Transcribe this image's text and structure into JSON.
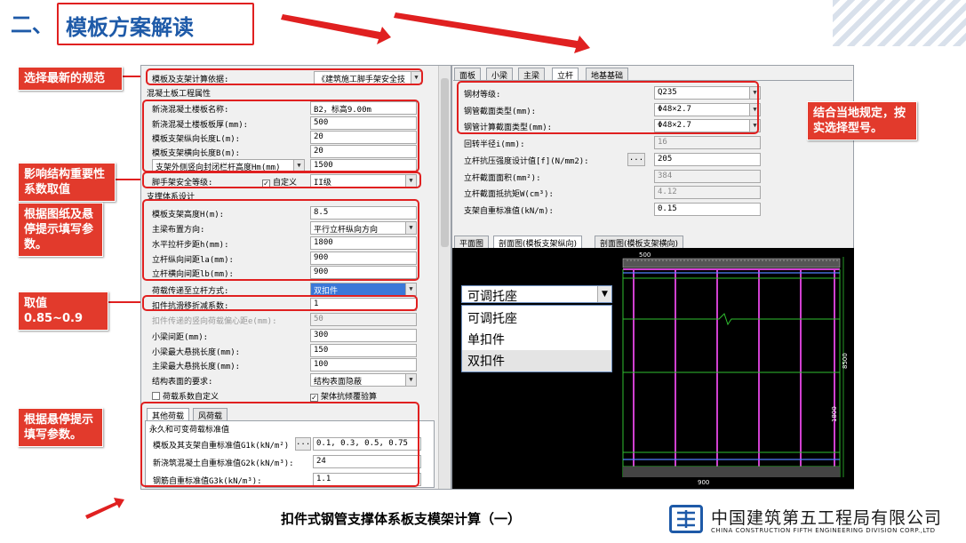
{
  "header": {
    "section_num": "二、",
    "title": "模板方案解读"
  },
  "annotations": {
    "a1": "选择最新的规范",
    "a2": "影响结构重要性系数取值",
    "a3": "根据图纸及悬停提示填写参数。",
    "a4": "取值0.85~0.9",
    "a5": "根据悬停提示填写参数。",
    "a6": "结合当地规定，按实选择型号。"
  },
  "left_panel": {
    "basis_label": "模板及支架计算依据:",
    "basis_value": "《建筑施工脚手架安全技",
    "sec1": "混凝土板工程属性",
    "r1_label": "新浇混凝土楼板名称:",
    "r1_value": "B2，标高9.00m",
    "r2_label": "新浇混凝土楼板板厚(mm):",
    "r2_value": "500",
    "r3_label": "模板支架纵向长度L(m):",
    "r3_value": "20",
    "r4_label": "模板支架横向长度B(m):",
    "r4_value": "20",
    "r5_label": "支架外侧竖向封闭栏杆高度Hm(mm)",
    "r5_value": "1500",
    "r6_label": "脚手架安全等级:",
    "r6_custom": "自定义",
    "r6_value": "II级",
    "sec2": "支撑体系设计",
    "r7_label": "模板支架高度H(m):",
    "r7_value": "8.5",
    "r8_label": "主梁布置方向:",
    "r8_value": "平行立杆纵向方向",
    "r9_label": "水平拉杆步距h(mm):",
    "r9_value": "1800",
    "r10_label": "立杆纵向间距la(mm):",
    "r10_value": "900",
    "r11_label": "立杆横向间距lb(mm):",
    "r11_value": "900",
    "r12_label": "荷载传递至立杆方式:",
    "r12_value": "双扣件",
    "r13_label": "扣件抗滑移折减系数:",
    "r13_value": "1",
    "r14_label": "扣件传递的竖向荷载偏心距e(mm):",
    "r14_value": "50",
    "r15_label": "小梁间距(mm):",
    "r15_value": "300",
    "r16_label": "小梁最大悬挑长度(mm):",
    "r16_value": "150",
    "r17_label": "主梁最大悬挑长度(mm):",
    "r17_value": "100",
    "r18_label": "结构表面的要求:",
    "r18_value": "结构表面隐蔽",
    "chk1": "荷载系数自定义",
    "chk2": "架体抗倾覆验算",
    "tab1": "其他荷载",
    "tab2": "风荷载",
    "sec3": "永久和可变荷载标准值",
    "r19_label": "模板及其支架自重标准值G1k(kN/m²)",
    "r19_btn": "...",
    "r19_value": "0.1, 0.3, 0.5, 0.75",
    "r20_label": "新浇筑混凝土自重标准值G2k(kN/m³):",
    "r20_value": "24",
    "r21_label": "钢筋自重标准值G3k(kN/m³):",
    "r21_value": "1.1"
  },
  "right_panel": {
    "tabs": [
      "面板",
      "小梁",
      "主梁",
      "立杆",
      "地基基础"
    ],
    "r1_label": "钢材等级:",
    "r1_value": "Q235",
    "r2_label": "钢管截面类型(mm):",
    "r2_value": "Φ48×2.7",
    "r3_label": "钢管计算截面类型(mm):",
    "r3_value": "Φ48×2.7",
    "r4_label": "回转半径i(mm):",
    "r4_value": "16",
    "r5_label": "立杆抗压强度设计值[f](N/mm2):",
    "r5_btn": "...",
    "r5_value": "205",
    "r6_label": "立杆截面面积(mm²):",
    "r6_value": "384",
    "r7_label": "立杆截面抵抗矩W(cm³):",
    "r7_value": "4.12",
    "r8_label": "支架自重标准值(kN/m):",
    "r8_value": "0.15",
    "view_tabs": [
      "平面图",
      "剖面图(模板支架纵向)",
      "剖面图(模板支架横向)"
    ],
    "dim_top": "500",
    "dim_right": "8500",
    "dim_mid": "1800",
    "dim_bot": "900"
  },
  "dropdown": {
    "head": "可调托座",
    "items": [
      "可调托座",
      "单扣件",
      "双扣件"
    ]
  },
  "footer": {
    "title": "扣件式钢管支撑体系板支模架计算（一）",
    "company_cn": "中国建筑第五工程局有限公司",
    "company_en": "CHINA CONSTRUCTION FIFTH ENGINEERING DIVISION CORP.,LTD"
  }
}
